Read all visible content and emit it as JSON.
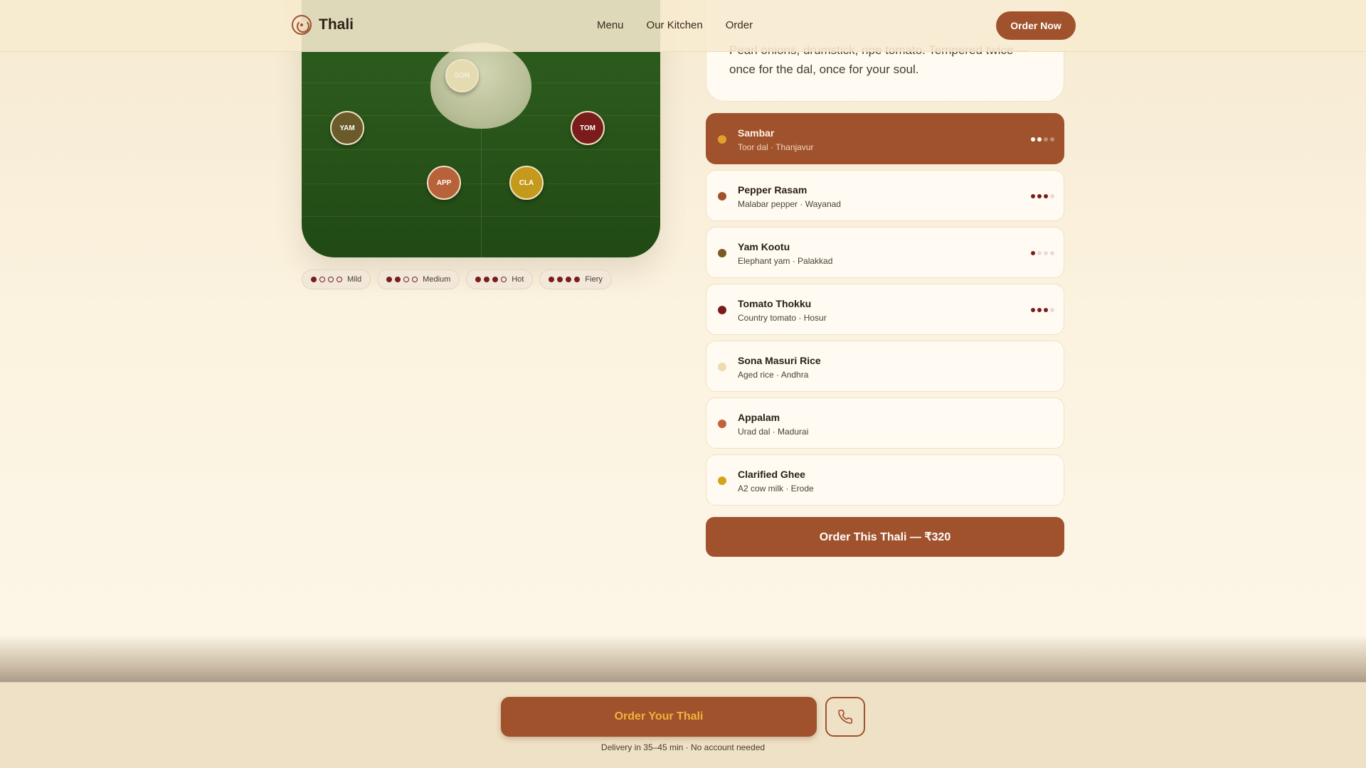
{
  "brand": {
    "name": "Thali",
    "accent": "#a0522d"
  },
  "nav": {
    "items": [
      {
        "label": "Menu"
      },
      {
        "label": "Our Kitchen"
      },
      {
        "label": "Order"
      }
    ],
    "cta_label": "Order Now"
  },
  "description": "Pearl onions, drumstick, ripe tomato. Tempered twice — once for the dal, once for your soul.",
  "plate": {
    "items": [
      {
        "code": "SON",
        "color": "#e4dbb0"
      },
      {
        "code": "YAM",
        "color": "#6b5a2a"
      },
      {
        "code": "TOM",
        "color": "#7a1c1c"
      },
      {
        "code": "APP",
        "color": "#b8623a"
      },
      {
        "code": "CLA",
        "color": "#c49a1c"
      }
    ]
  },
  "spice_legend": [
    {
      "label": "Mild",
      "level": 1
    },
    {
      "label": "Medium",
      "level": 2
    },
    {
      "label": "Hot",
      "level": 3
    },
    {
      "label": "Fiery",
      "level": 4
    }
  ],
  "dishes": [
    {
      "name": "Sambar",
      "meta": "Toor dal · Thanjavur",
      "dot_color": "#e0a12c",
      "heat": 2,
      "active": true
    },
    {
      "name": "Pepper Rasam",
      "meta": "Malabar pepper · Wayanad",
      "dot_color": "#a0522d",
      "heat": 3,
      "active": false
    },
    {
      "name": "Yam Kootu",
      "meta": "Elephant yam · Palakkad",
      "dot_color": "#7a5a22",
      "heat": 1,
      "active": false
    },
    {
      "name": "Tomato Thokku",
      "meta": "Country tomato · Hosur",
      "dot_color": "#7a1c1c",
      "heat": 3,
      "active": false
    },
    {
      "name": "Sona Masuri Rice",
      "meta": "Aged rice · Andhra",
      "dot_color": "#eedcae",
      "heat": 0,
      "active": false
    },
    {
      "name": "Appalam",
      "meta": "Urad dal · Madurai",
      "dot_color": "#c2623a",
      "heat": 0,
      "active": false
    },
    {
      "name": "Clarified Ghee",
      "meta": "A2 cow milk · Erode",
      "dot_color": "#d4a31c",
      "heat": 0,
      "active": false
    }
  ],
  "order_thali_label": "Order This Thali — ₹320",
  "bottom": {
    "order_label": "Order Your Thali",
    "call_icon": "phone-icon",
    "delivery_note": "Delivery in 35–45 min · No account needed"
  }
}
